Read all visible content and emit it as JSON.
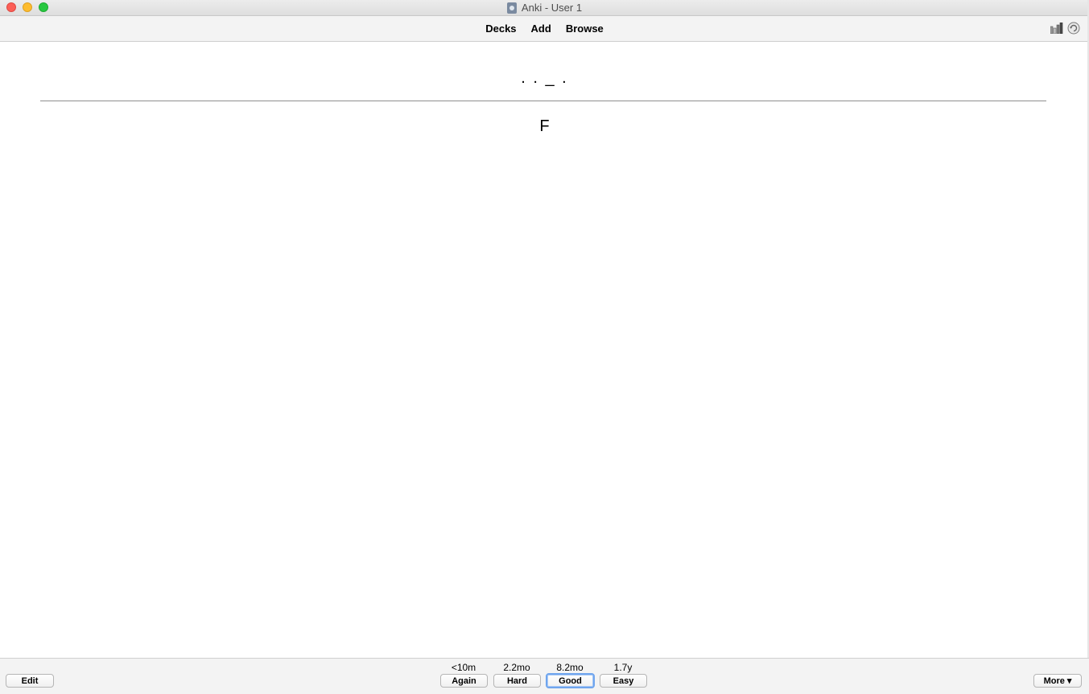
{
  "window": {
    "title": "Anki - User 1"
  },
  "toolbar": {
    "links": [
      "Decks",
      "Add",
      "Browse"
    ],
    "right_icons": [
      "stats-icon",
      "sync-icon"
    ]
  },
  "card": {
    "question": ". . _ .",
    "answer": "F"
  },
  "bottom": {
    "edit_label": "Edit",
    "more_label": "More ▾",
    "answers": [
      {
        "interval": "<10m",
        "label": "Again"
      },
      {
        "interval": "2.2mo",
        "label": "Hard"
      },
      {
        "interval": "8.2mo",
        "label": "Good",
        "default": true
      },
      {
        "interval": "1.7y",
        "label": "Easy"
      }
    ]
  }
}
